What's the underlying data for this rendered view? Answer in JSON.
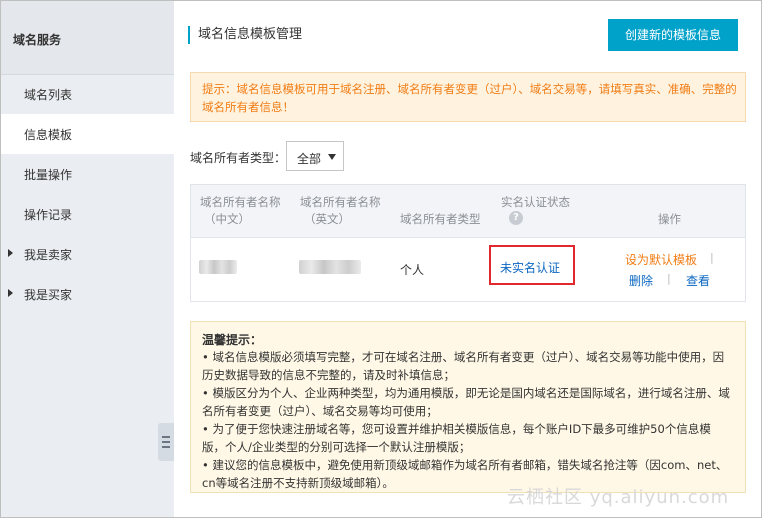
{
  "sidebar": {
    "title": "域名服务",
    "items": [
      {
        "label": "域名列表"
      },
      {
        "label": "信息模板"
      },
      {
        "label": "批量操作"
      },
      {
        "label": "操作记录"
      },
      {
        "label": "我是卖家"
      },
      {
        "label": "我是买家"
      }
    ],
    "active_index": 1
  },
  "header": {
    "title": "域名信息模板管理",
    "create_button": "创建新的模板信息"
  },
  "notice": {
    "text": "提示：域名信息模板可用于域名注册、域名所有者变更（过户）、域名交易等，请填写真实、准确、完整的域名所有者信息！"
  },
  "filter": {
    "label": "域名所有者类型：",
    "selected": "全部"
  },
  "table": {
    "headers": {
      "name_cn_1": "域名所有者名称",
      "name_cn_2": "（中文）",
      "name_en_1": "域名所有者名称",
      "name_en_2": "（英文）",
      "owner_type": "域名所有者类型",
      "verify_status": "实名认证状态",
      "actions": "操作"
    },
    "rows": [
      {
        "owner_type": "个人",
        "verify_status": "未实名认证",
        "action_default": "设为默认模板",
        "action_delete": "删除",
        "action_view": "查看"
      }
    ],
    "help_icon": "?"
  },
  "tips": {
    "title": "温馨提示：",
    "lines": [
      "• 域名信息模版必须填写完整，才可在域名注册、域名所有者变更（过户）、域名交易等功能中使用，因历史数据导致的信息不完整的，请及时补填信息；",
      "• 模版区分为个人、企业两种类型，均为通用模版，即无论是国内域名还是国际域名，进行域名注册、域名所有者变更（过户）、域名交易等均可使用；",
      "• 为了便于您快速注册域名等，您可设置并维护相关模版信息，每个账户ID下最多可维护50个信息模版，个人/企业类型的分别可选择一个默认注册模版；",
      "• 建议您的信息模板中，避免使用新顶级域邮箱作为域名所有者邮箱，错失域名抢注等（因com、net、cn等域名注册不支持新顶级域邮箱）。"
    ]
  },
  "watermark": "云栖社区 yq.aliyun.com",
  "colors": {
    "accent": "#00a2ca",
    "warning_text": "#f07c14",
    "link": "#0b67c2",
    "highlight_border": "#e0282e"
  }
}
